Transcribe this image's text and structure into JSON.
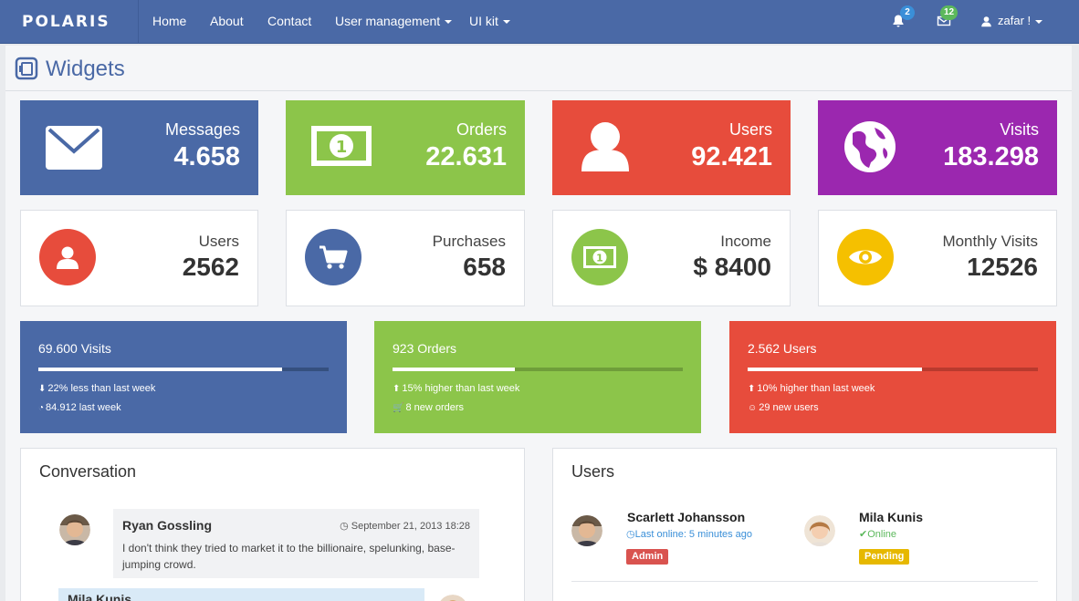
{
  "navbar": {
    "brand": "POLARIS",
    "items": [
      {
        "label": "Home"
      },
      {
        "label": "About"
      },
      {
        "label": "Contact"
      },
      {
        "label": "User management"
      },
      {
        "label": "UI kit"
      }
    ],
    "notifications_count": "2",
    "messages_count": "12",
    "user_label": "zafar !"
  },
  "page": {
    "title": "Widgets"
  },
  "stats": [
    {
      "label": "Messages",
      "value": "4.658",
      "color": "#4a69a6",
      "icon": "envelope-icon"
    },
    {
      "label": "Orders",
      "value": "22.631",
      "color": "#8cc54a",
      "icon": "money-icon"
    },
    {
      "label": "Users",
      "value": "92.421",
      "color": "#e74c3c",
      "icon": "user-icon"
    },
    {
      "label": "Visits",
      "value": "183.298",
      "color": "#9b27af",
      "icon": "globe-icon"
    }
  ],
  "cards": [
    {
      "label": "Users",
      "value": "2562",
      "color": "#e74c3c",
      "icon": "user-icon"
    },
    {
      "label": "Purchases",
      "value": "658",
      "color": "#4a69a6",
      "icon": "cart-icon"
    },
    {
      "label": "Income",
      "value": "$ 8400",
      "color": "#8cc54a",
      "icon": "money-icon"
    },
    {
      "label": "Monthly Visits",
      "value": "12526",
      "color": "#f5c000",
      "icon": "eye-icon"
    }
  ],
  "progress": [
    {
      "title": "69.600 Visits",
      "progress": 0.84,
      "line1": "22% less than last week",
      "line2": "84.912 last week",
      "color": "#4a69a6",
      "track": "#35507f"
    },
    {
      "title": "923 Orders",
      "progress": 0.42,
      "line1": "15% higher than last week",
      "line2": "8 new orders",
      "color": "#8cc54a",
      "track": "#6f9e3a"
    },
    {
      "title": "2.562 Users",
      "progress": 0.6,
      "line1": "10% higher than last week",
      "line2": "29 new users",
      "color": "#e74c3c",
      "track": "#b93a2e"
    }
  ],
  "conversation": {
    "title": "Conversation",
    "messages": [
      {
        "name": "Ryan Gossling",
        "time": "September 21, 2013 18:28",
        "text": "I don't think they tried to market it to the billionaire, spelunking, base-jumping crowd."
      },
      {
        "name": "Mila Kunis"
      }
    ]
  },
  "users_panel": {
    "title": "Users",
    "users": [
      {
        "name": "Scarlett Johansson",
        "status": "Last online: 5 minutes ago",
        "label": "Admin",
        "status_color": "#3a8fd8",
        "label_color": "#d9534f"
      },
      {
        "name": "Mila Kunis",
        "status": "Online",
        "label": "Pending",
        "status_color": "#5cb85c",
        "label_color": "#e6b800"
      }
    ]
  }
}
